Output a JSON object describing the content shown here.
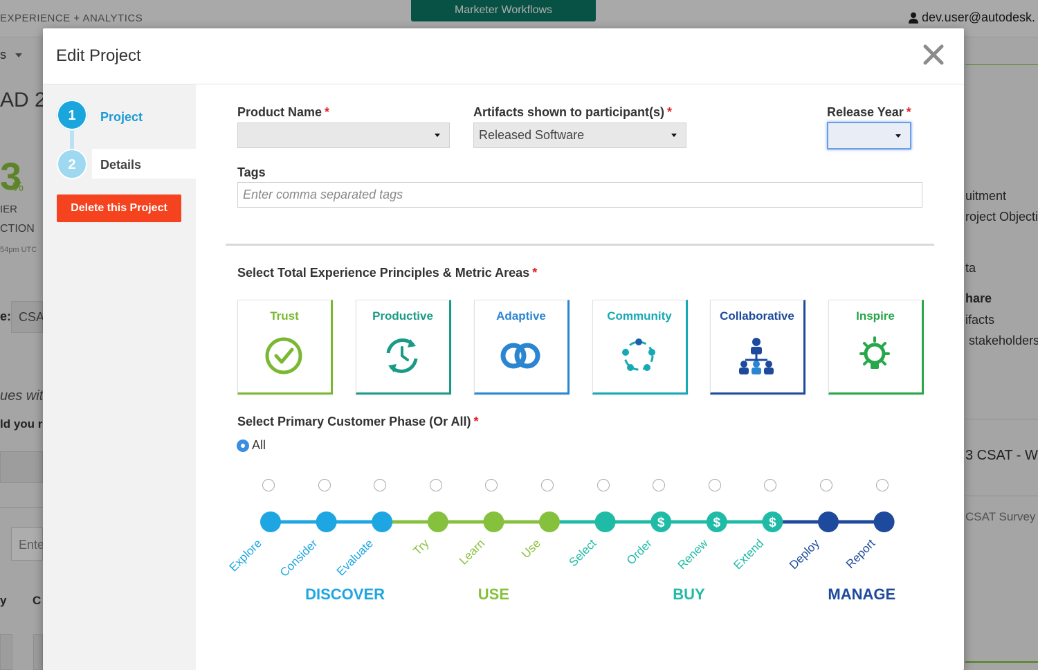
{
  "background": {
    "brand": "EXPERIENCE + ANALYTICS",
    "workflows_button": "Marketer Workflows",
    "user_email": "dev.user@autodesk.",
    "fragments": {
      "menu": "s",
      "title": "AD 2",
      "percent_digit": "3",
      "percent_sign": "%",
      "label_1": "IER",
      "label_2": "CTION",
      "timestamp": "54pm UTC",
      "field_label": "e:",
      "field_value": "CSA",
      "question_1": "ues wit",
      "question_2": "ld you r",
      "input_placeholder": "Ente",
      "col_1": "y",
      "col_2": "C",
      "right_1": "uitment",
      "right_2": "roject Objecti",
      "right_3": "ta",
      "right_4": "hare",
      "right_5": "ifacts",
      "right_6": "stakeholders",
      "right_7": "3 CSAT - W",
      "right_8": "CSAT Survey"
    }
  },
  "modal": {
    "title": "Edit Project",
    "close_icon": "close-x-icon"
  },
  "steps": [
    {
      "number": "1",
      "label": "Project"
    },
    {
      "number": "2",
      "label": "Details"
    }
  ],
  "delete_button": "Delete this Project",
  "form": {
    "product_name": {
      "label": "Product Name",
      "required": "*",
      "value": ""
    },
    "artifacts": {
      "label": "Artifacts shown to participant(s)",
      "required": "*",
      "value": "Released Software"
    },
    "release_year": {
      "label": "Release Year",
      "required": "*",
      "value": ""
    },
    "tags": {
      "label": "Tags",
      "placeholder": "Enter comma separated tags"
    },
    "principles_label": "Select Total Experience Principles & Metric Areas",
    "principles_required": "*",
    "phase_label": "Select Primary Customer Phase (Or All)",
    "phase_required": "*",
    "all_option": "All"
  },
  "principles": [
    {
      "name": "Trust",
      "icon": "check-circle-icon",
      "color": "#7ab833"
    },
    {
      "name": "Productive",
      "icon": "cycle-clock-icon",
      "color": "#1a9b87"
    },
    {
      "name": "Adaptive",
      "icon": "linked-rings-icon",
      "color": "#2b86d1"
    },
    {
      "name": "Community",
      "icon": "people-circle-icon",
      "color": "#16a9b5"
    },
    {
      "name": "Collaborative",
      "icon": "org-chart-icon",
      "color": "#1d4a9c"
    },
    {
      "name": "Inspire",
      "icon": "lightbulb-icon",
      "color": "#28a64a"
    }
  ],
  "journey": {
    "stages": [
      {
        "label": "Explore",
        "color": "#1ea6e2",
        "dollar": false
      },
      {
        "label": "Consider",
        "color": "#1ea6e2",
        "dollar": false
      },
      {
        "label": "Evaluate",
        "color": "#1ea6e2",
        "dollar": false
      },
      {
        "label": "Try",
        "color": "#86c13e",
        "dollar": false
      },
      {
        "label": "Learn",
        "color": "#86c13e",
        "dollar": false
      },
      {
        "label": "Use",
        "color": "#86c13e",
        "dollar": false
      },
      {
        "label": "Select",
        "color": "#20bba6",
        "dollar": false
      },
      {
        "label": "Order",
        "color": "#20bba6",
        "dollar": true
      },
      {
        "label": "Renew",
        "color": "#20bba6",
        "dollar": true
      },
      {
        "label": "Extend",
        "color": "#20bba6",
        "dollar": true
      },
      {
        "label": "Deploy",
        "color": "#1d4a9c",
        "dollar": false
      },
      {
        "label": "Report",
        "color": "#1d4a9c",
        "dollar": false
      }
    ],
    "phases": [
      {
        "label": "DISCOVER",
        "color": "#1ea6e2"
      },
      {
        "label": "USE",
        "color": "#86c13e"
      },
      {
        "label": "BUY",
        "color": "#20bba6"
      },
      {
        "label": "MANAGE",
        "color": "#1d4a9c"
      }
    ]
  }
}
